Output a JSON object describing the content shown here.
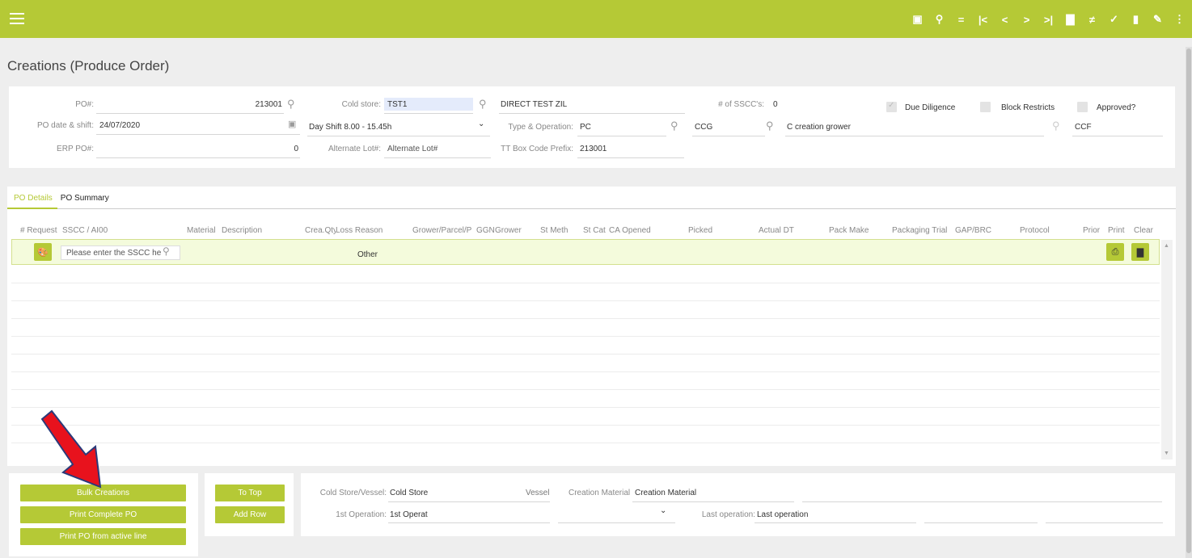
{
  "toolbar": {
    "icons": [
      "calendar-icon",
      "search-icon",
      "equals-icon",
      "first-icon",
      "prev-icon",
      "next-icon",
      "last-icon",
      "new-doc-icon",
      "filter-icon",
      "check-icon",
      "delete-icon",
      "wrench-icon",
      "more-icon"
    ],
    "glyphs": [
      "▣",
      "⚲",
      "=",
      "|<",
      "<",
      ">",
      ">|",
      "▇",
      "≠",
      "✓",
      "▮",
      "✎",
      "⋮"
    ]
  },
  "page": {
    "title": "Creations (Produce Order)"
  },
  "header": {
    "po_label": "PO#:",
    "po_value": "213001",
    "cold_store_label": "Cold store:",
    "cold_store_value": "TST1",
    "cold_store_desc": "DIRECT TEST ZIL",
    "sscc_count_label": "# of SSCC's:",
    "sscc_count_value": "0",
    "due_diligence_label": "Due Diligence",
    "block_restricts_label": "Block Restricts",
    "approved_label": "Approved?",
    "po_date_label": "PO date & shift:",
    "po_date_value": "24/07/2020",
    "shift_value": "Day Shift 8.00 - 15.45h",
    "type_op_label": "Type & Operation:",
    "type_op_value": "PC",
    "ccg_value": "CCG",
    "c_creation_value": "C creation grower",
    "ccf_value": "CCF",
    "erp_label": "ERP PO#:",
    "erp_value": "0",
    "alt_lot_label": "Alternate Lot#:",
    "alt_lot_placeholder": "Alternate Lot#",
    "tt_prefix_label": "TT Box Code Prefix:",
    "tt_prefix_value": "213001"
  },
  "tabs": [
    "PO Details",
    "PO Summary"
  ],
  "grid": {
    "columns": [
      "# Request",
      "SSCC / AI00",
      "Material",
      "Description",
      "Crea.Qty",
      "Loss Reason",
      "Grower/Parcel/P",
      "GGN",
      "Grower",
      "St Meth",
      "St Cat",
      "CA Opened",
      "Picked",
      "Actual DT",
      "Pack Make",
      "Packaging Trial",
      "GAP/BRC",
      "Protocol",
      "Prior",
      "Print",
      "Clear"
    ],
    "sscc_placeholder": "Please enter the SSCC he",
    "loss_reason": "Other"
  },
  "bottom": {
    "bulk_creations": "Bulk Creations",
    "print_complete_po": "Print Complete PO",
    "print_active_line": "Print PO from active line",
    "to_top": "To Top",
    "add_row": "Add Row",
    "cold_store_vessel_label": "Cold Store/Vessel:",
    "cold_store_value": "Cold Store",
    "vessel_label": "Vessel",
    "creation_material_label": "Creation Material",
    "creation_material_value": "Creation Material",
    "first_op_label": "1st Operation:",
    "first_op_value": "1st Operat",
    "last_op_label": "Last operation:",
    "last_op_value": "Last operation"
  },
  "colors": {
    "accent": "#b5c936",
    "arrow": "#e8121d"
  }
}
